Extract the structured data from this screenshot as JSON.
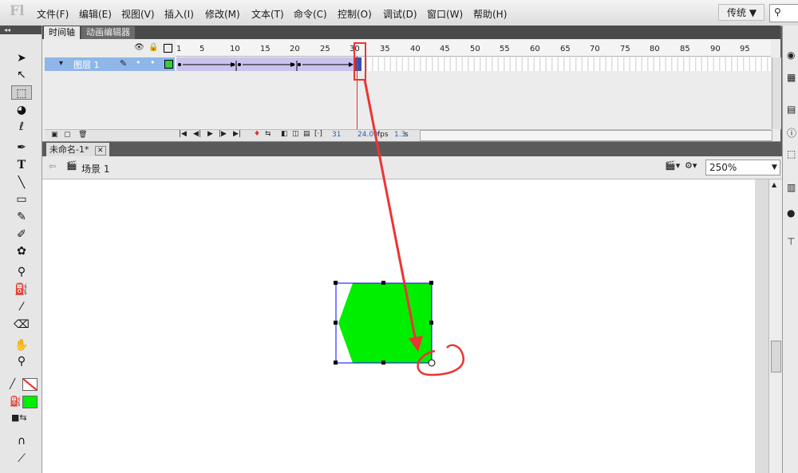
{
  "app": {
    "logo": "Fl",
    "workspace_label": "传统 ▼"
  },
  "menu": {
    "items": [
      "文件(F)",
      "编辑(E)",
      "视图(V)",
      "插入(I)",
      "修改(M)",
      "文本(T)",
      "命令(C)",
      "控制(O)",
      "调试(D)",
      "窗口(W)",
      "帮助(H)"
    ]
  },
  "timeline": {
    "tabs": [
      "时间轴",
      "动画编辑器"
    ],
    "ruler_ticks": [
      "1",
      "5",
      "10",
      "15",
      "20",
      "25",
      "30",
      "35",
      "40",
      "45",
      "50",
      "55",
      "60",
      "65",
      "70",
      "75",
      "80",
      "85",
      "90",
      "95"
    ],
    "layer_name": "图层 1",
    "current_frame": "31",
    "fps": "24.00",
    "fps_unit": "fps",
    "elapsed": "1.3",
    "elapsed_unit": "s"
  },
  "document": {
    "tab_title": "未命名-1*",
    "scene_label": "场景 1",
    "zoom_value": "250%"
  },
  "colors": {
    "fill": "#00ee00",
    "annotation": "#ee3333",
    "selection": "#0000ff"
  }
}
